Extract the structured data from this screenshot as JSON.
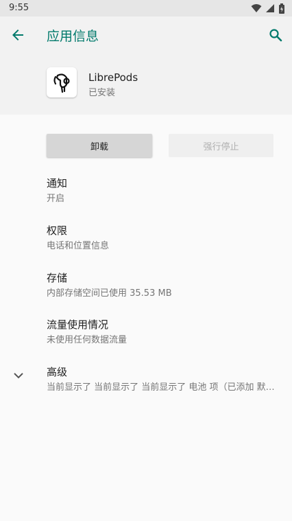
{
  "status_bar": {
    "time": "9:55",
    "icons": [
      "wifi-icon",
      "signal-icon",
      "battery-icon"
    ]
  },
  "toolbar": {
    "title": "应用信息",
    "back_icon": "arrow-back-icon",
    "search_icon": "search-icon",
    "accent_color": "#00796b"
  },
  "app": {
    "name": "LibrePods",
    "status": "已安装",
    "icon": "earbud-icon"
  },
  "buttons": {
    "uninstall": "卸载",
    "force_stop": "强行停止"
  },
  "preferences": [
    {
      "title": "通知",
      "summary": "开启"
    },
    {
      "title": "权限",
      "summary": "电话和位置信息"
    },
    {
      "title": "存储",
      "summary": "内部存储空间已使用 35.53 MB"
    },
    {
      "title": "流量使用情况",
      "summary": "未使用任何数据流量"
    },
    {
      "title": "高级",
      "summary": "当前显示了 当前显示了 当前显示了 电池 项（已添加 默认..."
    }
  ]
}
